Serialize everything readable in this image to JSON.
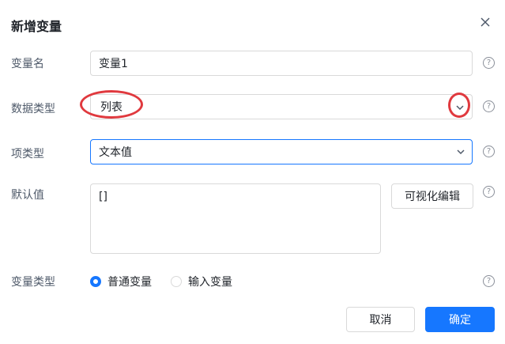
{
  "dialog": {
    "title": "新增变量",
    "close_icon": "close-icon"
  },
  "form": {
    "name": {
      "label": "变量名",
      "value": "变量1"
    },
    "data_type": {
      "label": "数据类型",
      "value": "列表"
    },
    "item_type": {
      "label": "项类型",
      "value": "文本值"
    },
    "default_value": {
      "label": "默认值",
      "value": "[]",
      "visual_edit_button": "可视化编辑"
    },
    "var_type": {
      "label": "变量类型",
      "options": [
        "普通变量",
        "输入变量"
      ],
      "selected": "普通变量"
    }
  },
  "help_icon": "?",
  "footer": {
    "cancel": "取消",
    "confirm": "确定"
  },
  "colors": {
    "primary": "#1677ff",
    "annotation": "#e0393e",
    "border": "#d9d9d9"
  }
}
